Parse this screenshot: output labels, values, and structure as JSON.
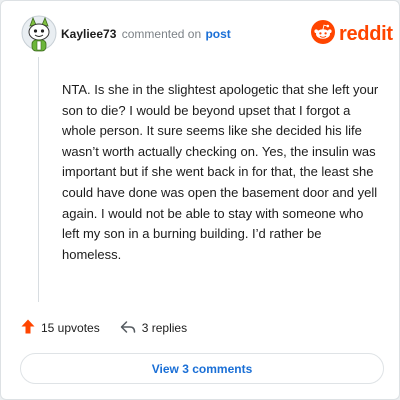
{
  "comment": {
    "username": "Kayliee73",
    "commented_text": "commented on",
    "post_link": "post",
    "brand": "reddit",
    "body": "NTA. Is she in the slightest apologetic that she left your son to die? I would be beyond upset that I forgot a whole person. It sure seems like she decided his life wasn’t worth actually checking on. Yes, the insulin was important but if she went back in for that, the least she could have done was open the basement door and yell again. I would not be able to stay with someone who left my son in a burning building. I’d rather be homeless."
  },
  "actions": {
    "upvotes_label": "15 upvotes",
    "replies_label": "3 replies"
  },
  "footer": {
    "view_comments_label": "View 3 comments"
  },
  "colors": {
    "accent": "#ff4500",
    "link": "#1a6fd6",
    "text": "#1c1c1c",
    "muted": "#7c8287"
  },
  "icons": {
    "avatar": "snoo-avatar",
    "brand": "reddit-alien-icon",
    "upvote": "upvote-arrow-icon",
    "reply": "reply-arrow-icon"
  }
}
